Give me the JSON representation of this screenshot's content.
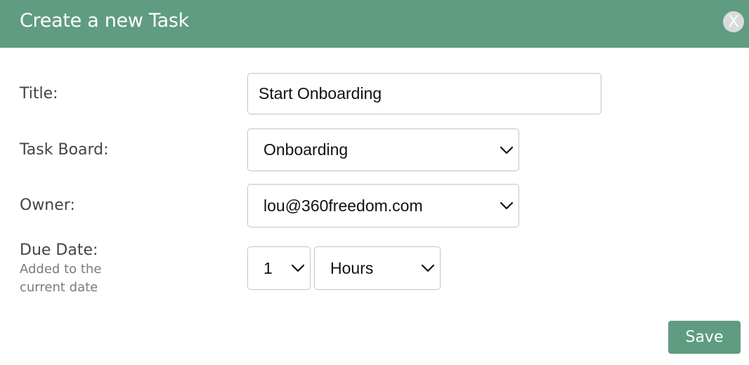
{
  "dialog": {
    "title": "Create a new Task",
    "close_label": "X"
  },
  "form": {
    "title_label": "Title:",
    "title_value": "Start Onboarding",
    "task_board_label": "Task Board:",
    "task_board_value": "Onboarding",
    "owner_label": "Owner:",
    "owner_value": "lou@360freedom.com",
    "due_date_label": "Due Date:",
    "due_date_hint_line1": "Added to the",
    "due_date_hint_line2": "current date",
    "due_amount_value": "1",
    "due_unit_value": "Hours"
  },
  "actions": {
    "save_label": "Save"
  },
  "colors": {
    "accent": "#5f9c82",
    "close_bg": "#d9dcdb",
    "field_border": "#c4c4c4"
  },
  "icons": {
    "dropdown": "chevron-down-icon"
  }
}
